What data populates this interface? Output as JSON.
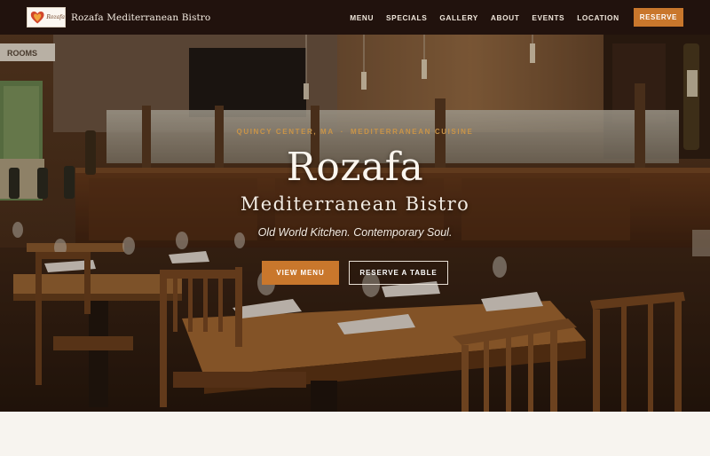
{
  "nav": {
    "logo_script": "Rozafa",
    "brand_name": "Rozafa Mediterranean Bistro",
    "links": [
      "MENU",
      "SPECIALS",
      "GALLERY",
      "ABOUT",
      "EVENTS",
      "LOCATION"
    ],
    "reserve_label": "RESERVE"
  },
  "hero": {
    "kicker_location": "QUINCY CENTER, MA",
    "kicker_separator": "·",
    "kicker_cuisine": "MEDITERRANEAN CUISINE",
    "title": "Rozafa",
    "subtitle": "Mediterranean Bistro",
    "tagline": "Old World Kitchen. Contemporary Soul.",
    "primary_button": "VIEW MENU",
    "secondary_button": "RESERVE A TABLE",
    "wall_sign": "ROOMS"
  },
  "colors": {
    "nav_bg": "#21120d",
    "accent": "#c9772c",
    "kicker": "#c99448",
    "page_bg": "#f6f3ee"
  }
}
